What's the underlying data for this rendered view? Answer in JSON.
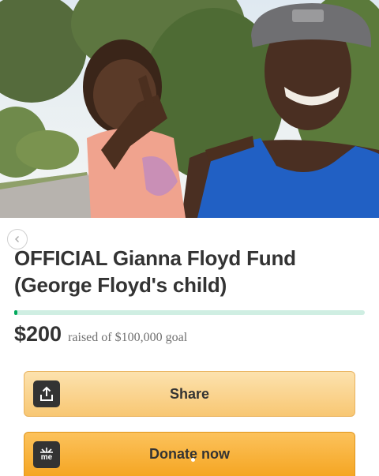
{
  "campaign": {
    "title": "OFFICIAL Gianna Floyd Fund (George Floyd's child)",
    "raised_amount": "$200",
    "goal_text": "raised of $100,000 goal",
    "progress_fraction": 0.002
  },
  "actions": {
    "share_label": "Share",
    "donate_label": "Donate now",
    "donate_icon_text": "me"
  },
  "icons": {
    "back": "chevron-left-icon",
    "share": "share-upload-icon",
    "gofundme": "gofundme-logo-icon"
  },
  "colors": {
    "progress_track": "#cfeee2",
    "progress_fill": "#02a95c",
    "share_button": "#f8c773",
    "donate_button": "#f5a623"
  }
}
